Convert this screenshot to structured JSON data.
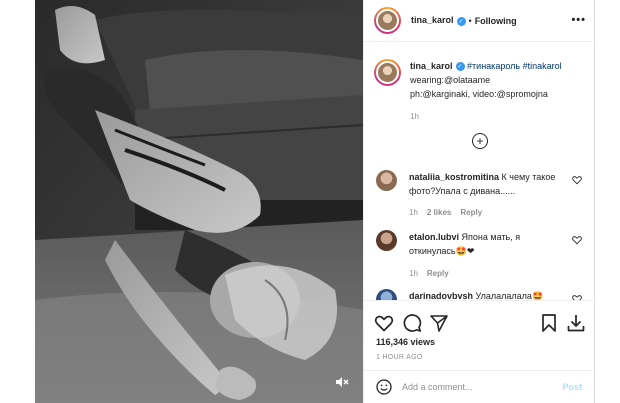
{
  "post": {
    "username": "tina_karol",
    "follow_status": "Following",
    "more_icon": "more-horizontal-icon",
    "verified_icon": "verified-badge-icon"
  },
  "caption": {
    "username": "tina_karol",
    "hashtags": "#тинакароль #tinakarol",
    "line2": "wearing:@olataame",
    "line3": "ph:@karginaki, video:@spromojna",
    "time": "1h"
  },
  "load_more_icon": "plus-circle-icon",
  "comments": [
    {
      "username": "nataliia_kostromitina",
      "text": "К чему такое фото?Упала с дивана......",
      "time": "1h",
      "likes": "2 likes",
      "reply": "Reply"
    },
    {
      "username": "etalon.lubvi",
      "text": "Япона мать, я откинулась",
      "emoji": "🤩❤",
      "time": "1h",
      "reply": "Reply"
    },
    {
      "username": "darinadovbvsh",
      "text": "Улалалалала",
      "emoji": "🤩"
    }
  ],
  "stats": {
    "views": "116,346 views",
    "time_ago": "1 HOUR AGO"
  },
  "composer": {
    "placeholder": "Add a comment...",
    "post_label": "Post",
    "emoji_icon": "smiley-icon"
  },
  "colors": {
    "link": "#00376b",
    "verified": "#3897f0",
    "muted": "#8e8e8e",
    "post_disabled": "#b2dffc"
  }
}
